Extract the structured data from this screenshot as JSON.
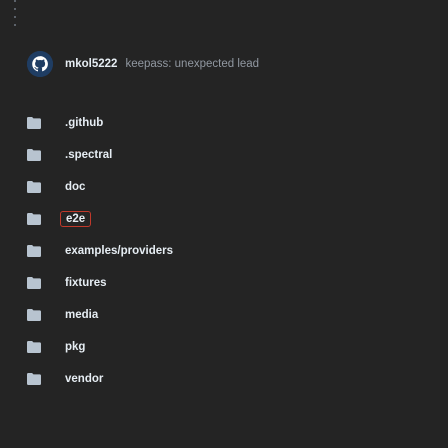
{
  "commit": {
    "author": "mkol5222",
    "message": "keepass: unexpected lead",
    "avatar_icon": "github-user-avatar-icon",
    "avatar_color": "#1f3d63"
  },
  "files": [
    {
      "name": ".github",
      "type": "folder",
      "selected": false
    },
    {
      "name": ".spectral",
      "type": "folder",
      "selected": false
    },
    {
      "name": "doc",
      "type": "folder",
      "selected": false
    },
    {
      "name": "e2e",
      "type": "folder",
      "selected": true
    },
    {
      "name": "examples/providers",
      "type": "folder",
      "selected": false
    },
    {
      "name": "fixtures",
      "type": "folder",
      "selected": false
    },
    {
      "name": "media",
      "type": "folder",
      "selected": false
    },
    {
      "name": "pkg",
      "type": "folder",
      "selected": false
    },
    {
      "name": "vendor",
      "type": "folder",
      "selected": false
    }
  ],
  "colors": {
    "background": "#242424",
    "folder": "#b8c4d0",
    "text": "#e6edf3",
    "muted": "#9198a1",
    "selection_border": "#c0392b"
  }
}
